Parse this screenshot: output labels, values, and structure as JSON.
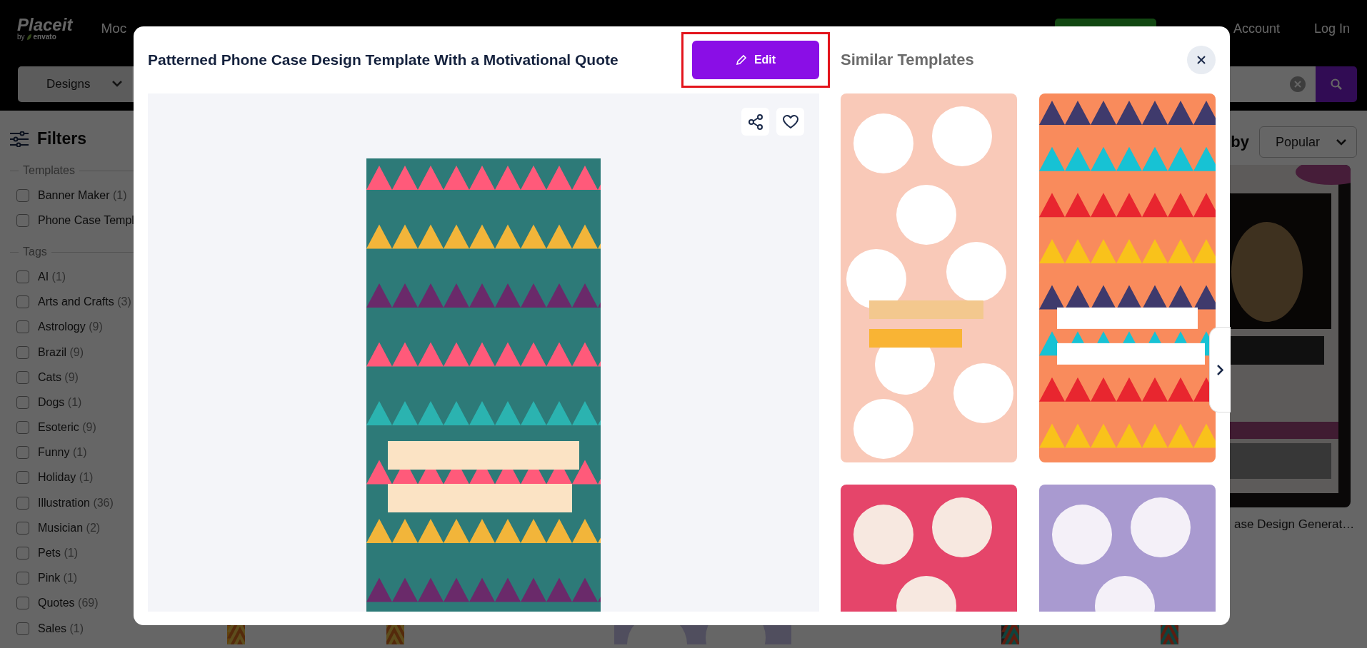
{
  "header": {
    "logo": "Placeit",
    "logo_by": "by",
    "logo_brand": "envato",
    "nav": [
      "Moc"
    ],
    "links": [
      "Account",
      "Log In"
    ]
  },
  "search_bar": {
    "category": "Designs"
  },
  "filters": {
    "title": "Filters",
    "groups": [
      {
        "title": "Templates",
        "items": [
          {
            "label": "Banner Maker",
            "count": "(1)",
            "checked": false
          },
          {
            "label": "Phone Case Templ",
            "checked": false
          }
        ]
      },
      {
        "title": "Tags",
        "items": [
          {
            "label": "AI",
            "count": "(1)",
            "checked": false
          },
          {
            "label": "Arts and Crafts",
            "count": "(3)",
            "checked": false
          },
          {
            "label": "Astrology",
            "count": "(9)",
            "checked": false
          },
          {
            "label": "Brazil",
            "count": "(9)",
            "checked": false
          },
          {
            "label": "Cats",
            "count": "(9)",
            "checked": false
          },
          {
            "label": "Dogs",
            "count": "(1)",
            "checked": false
          },
          {
            "label": "Esoteric",
            "count": "(9)",
            "checked": false
          },
          {
            "label": "Funny",
            "count": "(1)",
            "checked": false
          },
          {
            "label": "Holiday",
            "count": "(1)",
            "checked": false
          },
          {
            "label": "Illustration",
            "count": "(36)",
            "checked": false
          },
          {
            "label": "Musician",
            "count": "(2)",
            "checked": false
          },
          {
            "label": "Pets",
            "count": "(1)",
            "checked": false
          },
          {
            "label": "Pink",
            "count": "(1)",
            "checked": false
          },
          {
            "label": "Quotes",
            "count": "(69)",
            "checked": false
          },
          {
            "label": "Sales",
            "count": "(1)",
            "checked": false
          }
        ]
      }
    ]
  },
  "sort": {
    "label": "by",
    "value": "Popular"
  },
  "results": [
    {
      "kind": "picture",
      "title": "ase Design Generat…"
    }
  ],
  "modal": {
    "title": "Patterned Phone Case Design Template With a Motivational Quote",
    "edit_button": "Edit",
    "highlighted": true,
    "similar_title": "Similar Templates"
  }
}
